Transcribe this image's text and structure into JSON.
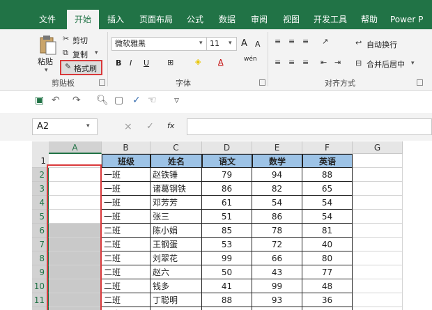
{
  "ribbon_tabs": [
    {
      "label": "文件",
      "active": false
    },
    {
      "label": "开始",
      "active": true
    },
    {
      "label": "插入",
      "active": false
    },
    {
      "label": "页面布局",
      "active": false
    },
    {
      "label": "公式",
      "active": false
    },
    {
      "label": "数据",
      "active": false
    },
    {
      "label": "审阅",
      "active": false
    },
    {
      "label": "视图",
      "active": false
    },
    {
      "label": "开发工具",
      "active": false
    },
    {
      "label": "帮助",
      "active": false
    },
    {
      "label": "Power P",
      "active": false
    }
  ],
  "clipboard": {
    "paste": "粘贴",
    "cut": "剪切",
    "copy": "复制",
    "format_painter": "格式刷",
    "group_label": "剪贴板"
  },
  "font": {
    "font_name": "微软雅黑",
    "font_size": "11",
    "group_label": "字体",
    "grow_label": "A",
    "shrink_label": "A",
    "bold": "B",
    "italic": "I",
    "underline": "U",
    "font_color_label": "A",
    "phonetic_label": "wén"
  },
  "alignment": {
    "wrap_text": "自动换行",
    "merge_center": "合并后居中",
    "group_label": "对齐方式"
  },
  "name_box": "A2",
  "formula_bar": {
    "cancel": "×",
    "enter": "✓",
    "fx": "fx",
    "value": ""
  },
  "columns": [
    "A",
    "B",
    "C",
    "D",
    "E",
    "F",
    "G"
  ],
  "rows": [
    "1",
    "2",
    "3",
    "4",
    "5",
    "6",
    "7",
    "8",
    "9",
    "10",
    "11",
    "12"
  ],
  "table": {
    "headers": [
      "班级",
      "姓名",
      "语文",
      "数学",
      "英语"
    ],
    "rows": [
      [
        "一班",
        "赵铁锤",
        "79",
        "94",
        "88"
      ],
      [
        "一班",
        "诸葛钢铁",
        "86",
        "82",
        "65"
      ],
      [
        "一班",
        "邓芳芳",
        "61",
        "54",
        "54"
      ],
      [
        "一班",
        "张三",
        "51",
        "86",
        "54"
      ],
      [
        "二班",
        "陈小娟",
        "85",
        "78",
        "81"
      ],
      [
        "二班",
        "王钢蛋",
        "53",
        "72",
        "40"
      ],
      [
        "二班",
        "刘翠花",
        "99",
        "66",
        "80"
      ],
      [
        "二班",
        "赵六",
        "50",
        "43",
        "77"
      ],
      [
        "二班",
        "钱多",
        "41",
        "99",
        "48"
      ],
      [
        "二班",
        "丁聪明",
        "88",
        "93",
        "36"
      ],
      [
        "二班",
        "",
        "",
        "",
        ""
      ]
    ]
  },
  "colors": {
    "ribbon_green": "#217346",
    "header_fill": "#9dc3e6",
    "grey_fill": "#c9c9c9",
    "highlight_red": "#d9383a"
  }
}
